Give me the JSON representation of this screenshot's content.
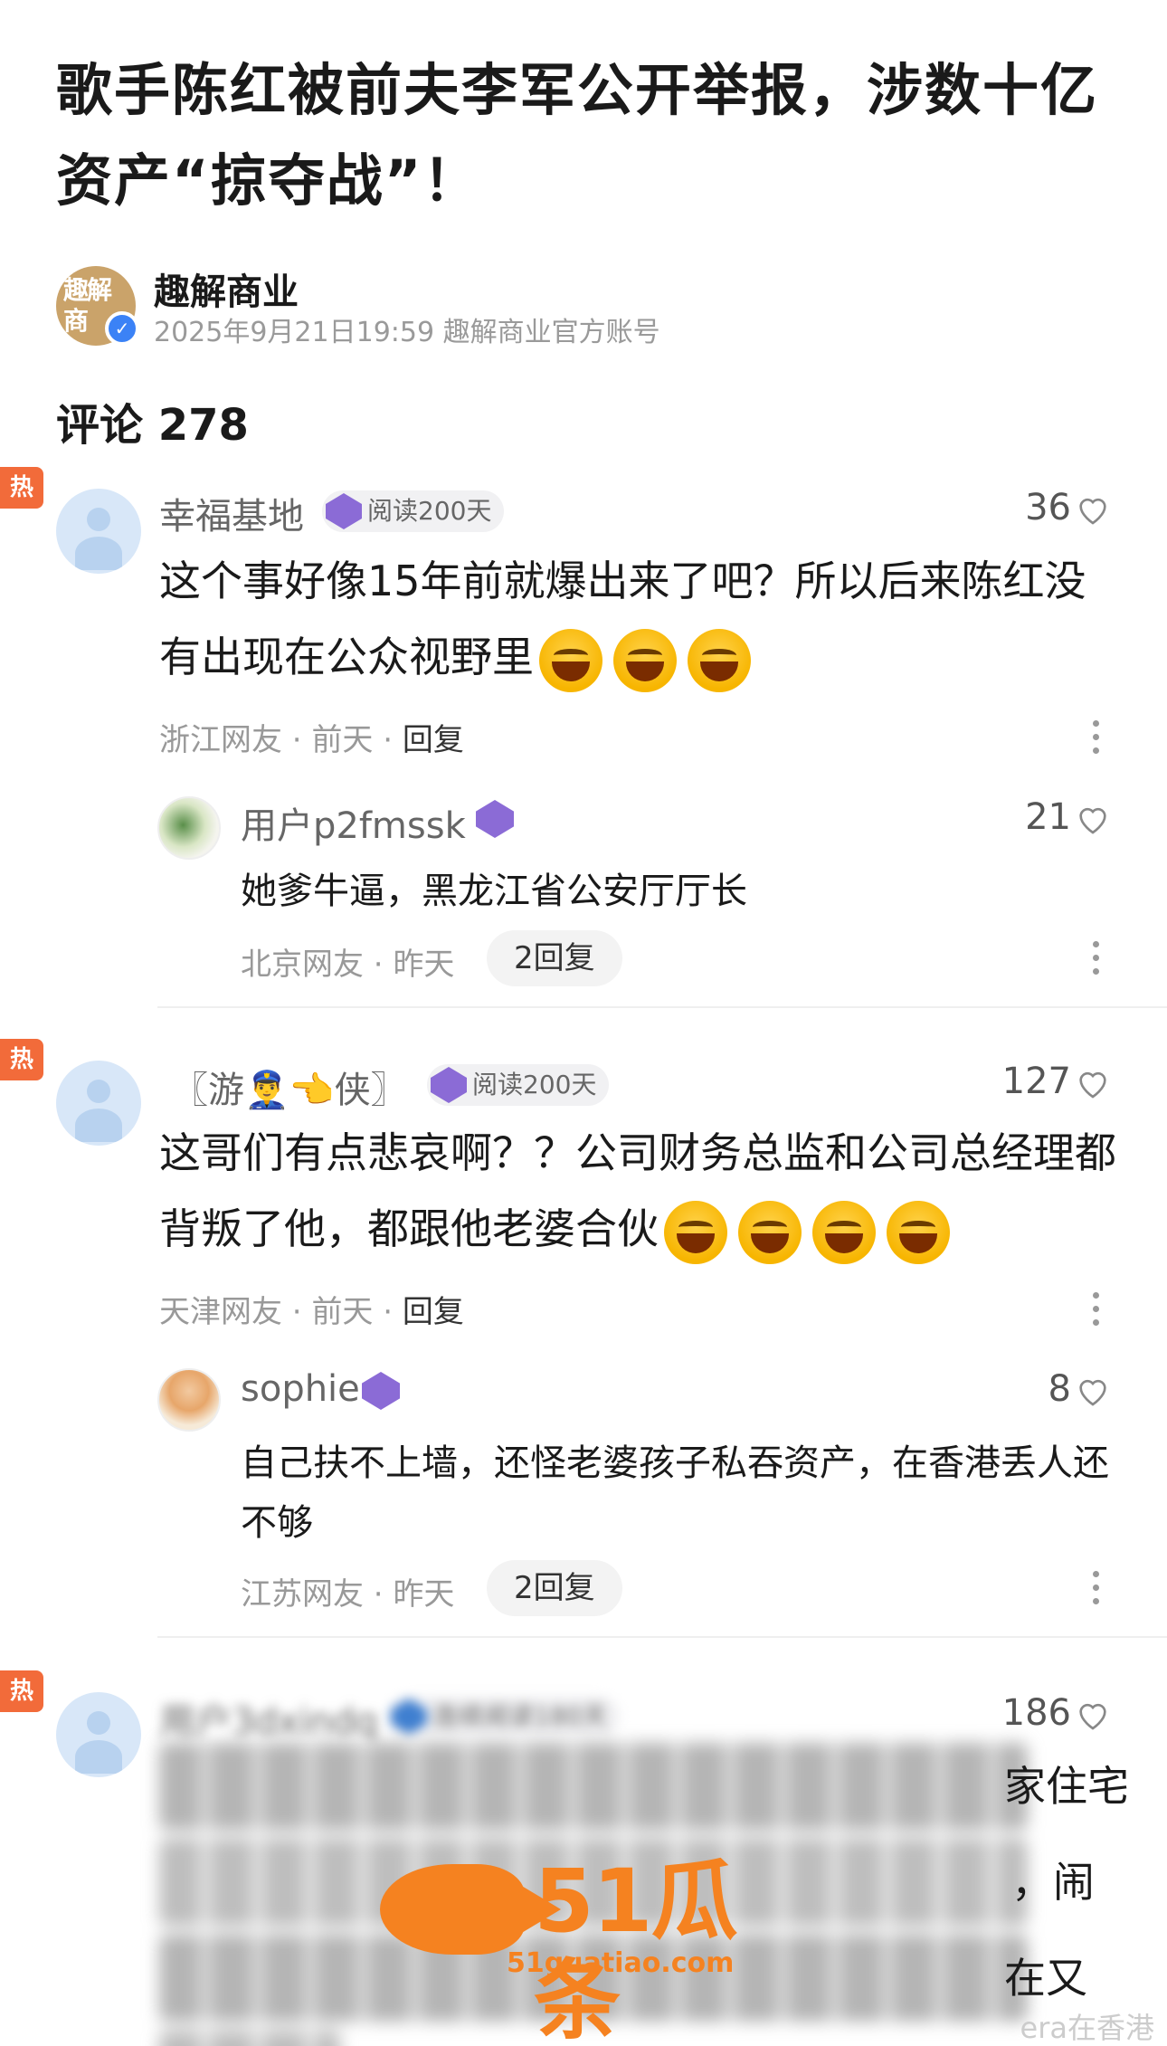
{
  "article": {
    "title": "歌手陈红被前夫李军公开举报，涉数十亿资产“掠夺战”！"
  },
  "author": {
    "name": "趣解商业",
    "logo_text": "趣解商",
    "meta": "2025年9月21日19:59 趣解商业官方账号"
  },
  "comments_header": "评论 278",
  "hot_label": "热",
  "comments": [
    {
      "username": "幸福基地",
      "badge": "阅读200天",
      "likes": "36",
      "text": "这个事好像15年前就爆出来了吧？所以后来陈红没有出现在公众视野里",
      "location": "浙江网友",
      "time": "前天",
      "reply_label": "回复",
      "reply": {
        "username": "用户p2fmssk",
        "likes": "21",
        "text": "她爹牛逼，黑龙江省公安厅厅长",
        "location": "北京网友",
        "time": "昨天",
        "replies_pill": "2回复"
      }
    },
    {
      "username": "〖游👮‍♂️👈侠〗",
      "badge": "阅读200天",
      "likes": "127",
      "text": "这哥们有点悲哀啊？？公司财务总监和公司总经理都背叛了他，都跟他老婆合伙",
      "location": "天津网友",
      "time": "前天",
      "reply_label": "回复",
      "reply": {
        "username": "sophie",
        "likes": "8",
        "text": "自己扶不上墙，还怪老婆孩子私吞资产，在香港丢人还不够",
        "location": "江苏网友",
        "time": "昨天",
        "replies_pill": "2回复"
      }
    },
    {
      "username": "用户3dxindq",
      "badge": "连续阅读180天",
      "likes": "186",
      "visible_fragments": [
        "家住宅",
        "，闹",
        "在又"
      ]
    }
  ],
  "watermark": {
    "brand": "51瓜条",
    "url": "51guatiao.com"
  },
  "credit": "era在香港"
}
